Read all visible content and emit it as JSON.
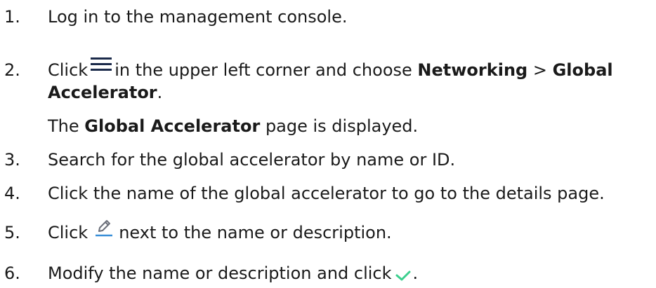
{
  "steps": [
    {
      "num": "1.",
      "text": "Log in to the management console."
    },
    {
      "num": "2.",
      "pre": "Click",
      "icon": "menu-icon",
      "mid": "in the upper left corner and choose",
      "bold1": "Networking",
      "sep": ">",
      "bold2a": "Global",
      "bold2b": "Accelerator",
      "end": ".",
      "note_bold": "Global Accelerator",
      "note_rest": "page is displayed.",
      "note_pre": "The"
    },
    {
      "num": "3.",
      "text": "Search for the global accelerator by name or ID."
    },
    {
      "num": "4.",
      "text": "Click the name of the global accelerator to go to the details page."
    },
    {
      "num": "5.",
      "pre": "Click",
      "icon": "edit-icon",
      "post": "next to the name or description."
    },
    {
      "num": "6.",
      "pre": "Modify the name or description and click",
      "icon": "check-icon",
      "post": "."
    }
  ],
  "colors": {
    "text": "#1a1a1a",
    "menu_icon": "#1b2a4a",
    "edit_icon": "#6b6f7a",
    "edit_underline": "#3a8fd8",
    "check_icon": "#3ccf8e"
  }
}
